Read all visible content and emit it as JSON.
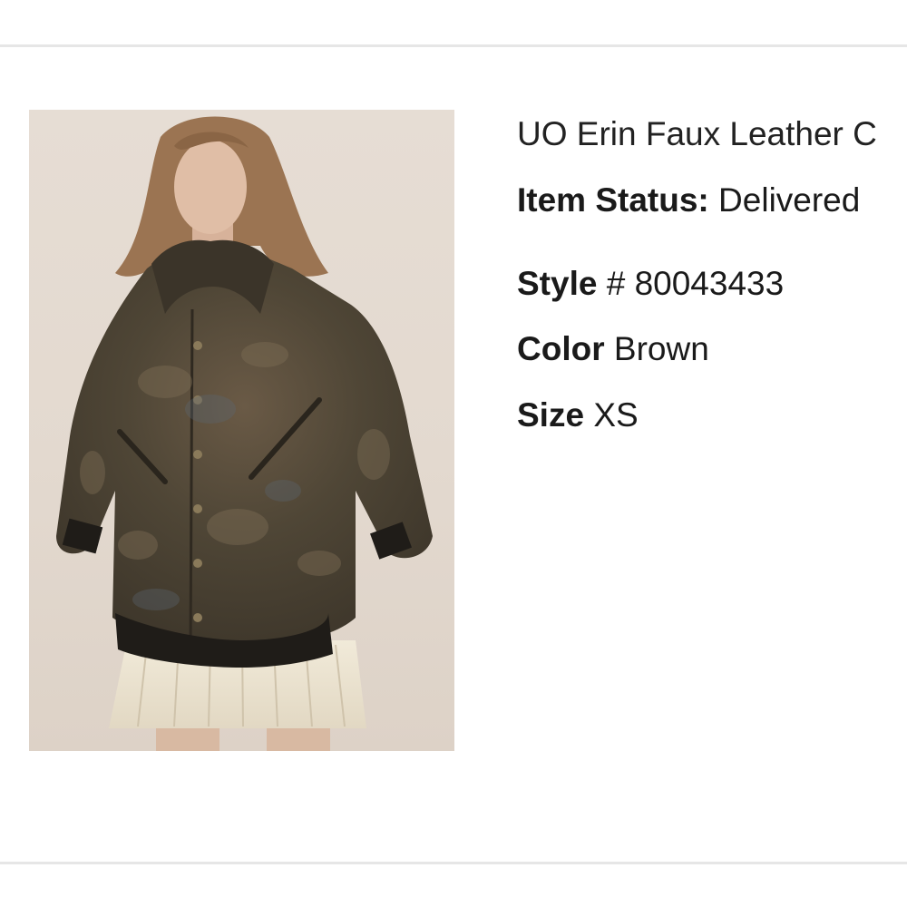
{
  "product": {
    "title": "UO Erin Faux Leather C",
    "image_alt": "Model wearing distressed brown faux leather bomber jacket",
    "status_label": "Item Status:",
    "status_value": "Delivered",
    "style_label": "Style",
    "style_value": "# 80043433",
    "color_label": "Color",
    "color_value": "Brown",
    "size_label": "Size",
    "size_value": "XS"
  }
}
